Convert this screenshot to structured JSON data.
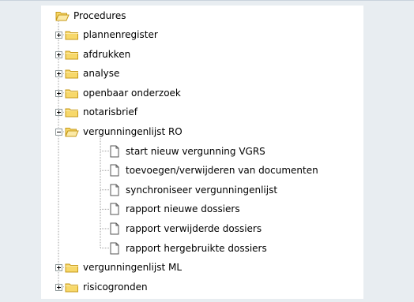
{
  "tree": {
    "root": {
      "label": "Procedures",
      "icon": "folder-open-icon"
    },
    "items": [
      {
        "label": "plannenregister",
        "icon": "folder-icon",
        "expander": "plus"
      },
      {
        "label": "afdrukken",
        "icon": "folder-icon",
        "expander": "plus"
      },
      {
        "label": "analyse",
        "icon": "folder-icon",
        "expander": "plus"
      },
      {
        "label": "openbaar onderzoek",
        "icon": "folder-icon",
        "expander": "plus"
      },
      {
        "label": "notarisbrief",
        "icon": "folder-icon",
        "expander": "plus"
      },
      {
        "label": "vergunningenlijst RO",
        "icon": "folder-open-icon",
        "expander": "minus",
        "children": [
          {
            "label": "start nieuw vergunning VGRS",
            "icon": "document-icon"
          },
          {
            "label": "toevoegen/verwijderen van documenten",
            "icon": "document-icon"
          },
          {
            "label": "synchroniseer vergunningenlijst",
            "icon": "document-icon"
          },
          {
            "label": "rapport nieuwe dossiers",
            "icon": "document-icon"
          },
          {
            "label": "rapport verwijderde dossiers",
            "icon": "document-icon"
          },
          {
            "label": "rapport hergebruikte dossiers",
            "icon": "document-icon"
          }
        ]
      },
      {
        "label": "vergunningenlijst ML",
        "icon": "folder-icon",
        "expander": "plus"
      },
      {
        "label": "risicogronden",
        "icon": "folder-icon",
        "expander": "plus"
      }
    ]
  },
  "colors": {
    "background": "#e8edf1",
    "tree_background": "#ffffff",
    "folder_fill": "#f7d86a",
    "folder_stroke": "#c79a1a",
    "tree_line": "#a0a0a0"
  }
}
